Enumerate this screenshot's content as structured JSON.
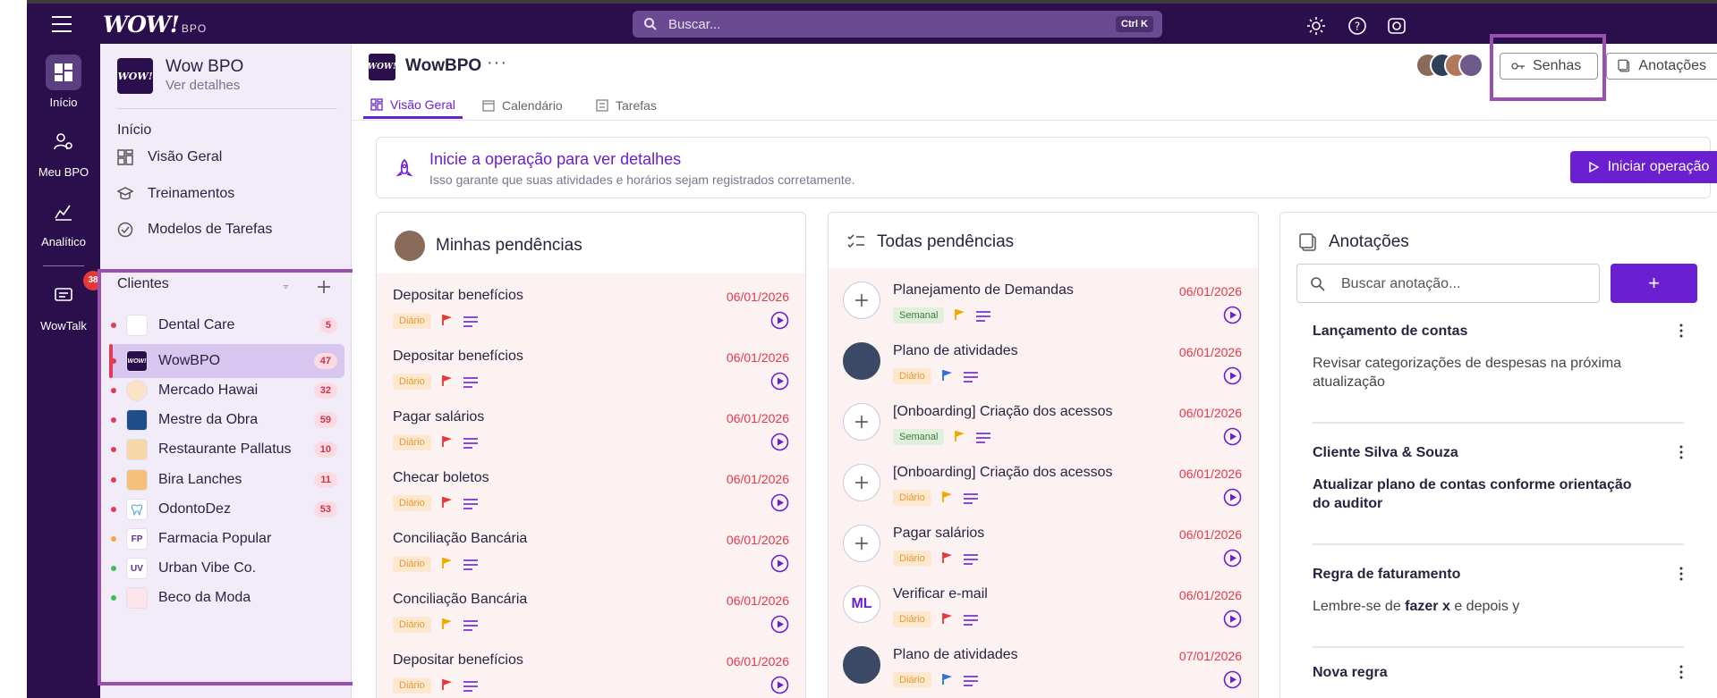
{
  "topbar": {
    "logo": "WOW!",
    "logo_suffix": "BPO",
    "search_placeholder": "Buscar...",
    "search_shortcut": "Ctrl K"
  },
  "rail": {
    "items": [
      {
        "label": "Início",
        "icon": "grid-icon"
      },
      {
        "label": "Meu BPO",
        "icon": "users-gear-icon"
      },
      {
        "label": "Analítico",
        "icon": "chart-icon"
      },
      {
        "label": "WowTalk",
        "icon": "chat-icon",
        "badge": "38"
      }
    ]
  },
  "sidebar": {
    "org_logo": "WOW!",
    "org_name": "Wow BPO",
    "org_sub": "Ver detalhes",
    "section_title": "Início",
    "nav": [
      {
        "label": "Visão Geral",
        "icon": "dashboard-icon"
      },
      {
        "label": "Treinamentos",
        "icon": "graduation-icon"
      },
      {
        "label": "Modelos de Tarefas",
        "icon": "check-circle-icon"
      }
    ],
    "clients_title": "Clientes",
    "clients": [
      {
        "name": "Dental Care",
        "count": "5",
        "dot": "#e53955",
        "av": ""
      },
      {
        "name": "WowBPO",
        "count": "47",
        "dot": "#e53955",
        "av": "WOW!"
      },
      {
        "name": "Mercado Hawai",
        "count": "32",
        "dot": "#e53955",
        "av": ""
      },
      {
        "name": "Mestre da Obra",
        "count": "59",
        "dot": "#e53955",
        "av": ""
      },
      {
        "name": "Restaurante Pallatus",
        "count": "10",
        "dot": "#e53955",
        "av": ""
      },
      {
        "name": "Bira Lanches",
        "count": "11",
        "dot": "#e53955",
        "av": ""
      },
      {
        "name": "OdontoDez",
        "count": "53",
        "dot": "#e53955",
        "av": ""
      },
      {
        "name": "Farmacia Popular",
        "count": "",
        "dot": "#f2a93b",
        "av": "FP"
      },
      {
        "name": "Urban Vibe Co.",
        "count": "",
        "dot": "#3cbf5c",
        "av": "UV"
      },
      {
        "name": "Beco da Moda",
        "count": "",
        "dot": "#3cbf5c",
        "av": ""
      }
    ]
  },
  "workspace": {
    "logo": "WOW!",
    "name": "WowBPO",
    "more": "···",
    "senhas_label": "Senhas",
    "anotacoes_label": "Anotações",
    "tabs": [
      {
        "label": "Visão Geral",
        "icon": "dashboard-icon"
      },
      {
        "label": "Calendário",
        "icon": "calendar-icon"
      },
      {
        "label": "Tarefas",
        "icon": "list-icon"
      }
    ]
  },
  "banner": {
    "title": "Inicie a operação para ver detalhes",
    "subtitle": "Isso garante que suas atividades e horários sejam registrados corretamente.",
    "button": "Iniciar operação"
  },
  "minhas": {
    "title": "Minhas pendências",
    "tasks": [
      {
        "name": "Depositar benefícios",
        "date": "06/01/2026",
        "freq": "Diário",
        "flag": "#e53935"
      },
      {
        "name": "Depositar benefícios",
        "date": "06/01/2026",
        "freq": "Diário",
        "flag": "#e53935"
      },
      {
        "name": "Pagar salários",
        "date": "06/01/2026",
        "freq": "Diário",
        "flag": "#e53935"
      },
      {
        "name": "Checar boletos",
        "date": "06/01/2026",
        "freq": "Diário",
        "flag": "#e53935"
      },
      {
        "name": "Conciliação Bancária",
        "date": "06/01/2026",
        "freq": "Diário",
        "flag": "#f2a600"
      },
      {
        "name": "Conciliação Bancária",
        "date": "06/01/2026",
        "freq": "Diário",
        "flag": "#f2a600"
      },
      {
        "name": "Depositar benefícios",
        "date": "06/01/2026",
        "freq": "Diário",
        "flag": "#e53935"
      }
    ]
  },
  "todas": {
    "title": "Todas pendências",
    "tasks": [
      {
        "name": "Planejamento de Demandas",
        "date": "06/01/2026",
        "freq": "Semanal",
        "flag": "#f2a600",
        "lead": "plus"
      },
      {
        "name": "Plano de atividades",
        "date": "06/01/2026",
        "freq": "Diário",
        "flag": "#2f6fd6",
        "lead": "photo"
      },
      {
        "name": "[Onboarding] Criação dos acessos",
        "date": "06/01/2026",
        "freq": "Semanal",
        "flag": "#f2a600",
        "lead": "plus"
      },
      {
        "name": "[Onboarding] Criação dos acessos",
        "date": "06/01/2026",
        "freq": "Diário",
        "flag": "#f2a600",
        "lead": "plus"
      },
      {
        "name": "Pagar salários",
        "date": "06/01/2026",
        "freq": "Diário",
        "flag": "#e53935",
        "lead": "plus"
      },
      {
        "name": "Verificar e-mail",
        "date": "06/01/2026",
        "freq": "Diário",
        "flag": "#e53935",
        "lead": "ML"
      },
      {
        "name": "Plano de atividades",
        "date": "07/01/2026",
        "freq": "Diário",
        "flag": "#2f6fd6",
        "lead": "photo"
      }
    ]
  },
  "anotacoes": {
    "title": "Anotações",
    "search_placeholder": "Buscar anotação...",
    "add_label": "+",
    "notes": [
      {
        "title": "Lançamento de contas",
        "body": "Revisar categorizações de despesas na próxima atualização",
        "strong": false
      },
      {
        "title": "Cliente Silva & Souza",
        "body": "Atualizar plano de contas conforme orientação do auditor",
        "strong": true
      },
      {
        "title": "Regra de faturamento",
        "body_pre": "Lembre-se de ",
        "body_bold": "fazer x",
        "body_post": " e depois y"
      },
      {
        "title": "Nova regra",
        "body": ""
      }
    ]
  },
  "colors": {
    "brand": "#2b0f4d",
    "accent": "#6a1fd0",
    "danger": "#e5374a"
  }
}
